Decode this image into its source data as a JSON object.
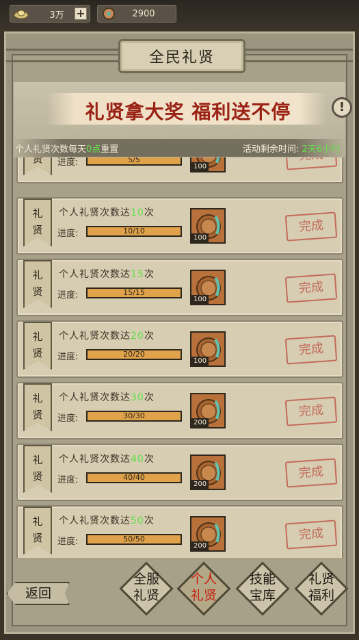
{
  "resources": {
    "gold": {
      "icon": "gold-ingot-icon",
      "value": "3万",
      "add_label": "+"
    },
    "gems": {
      "icon": "jade-coin-icon",
      "value": "2900"
    }
  },
  "title": "全民礼贤",
  "slogan": "礼贤拿大奖 福利送不停",
  "info_label": "!",
  "reset_note": {
    "prefix": "个人礼贤次数每天",
    "time": "0点",
    "suffix": "重置"
  },
  "remaining": {
    "label": "活动剩余时间:",
    "value": "2天6小时"
  },
  "tasks": [
    {
      "ribbon1": "礼",
      "ribbon2": "贤",
      "title_prefix": "",
      "target": "",
      "title_suffix": "",
      "progress_label": "进度:",
      "progress": "5/5",
      "reward_amount": "100",
      "status": "完成"
    },
    {
      "ribbon1": "礼",
      "ribbon2": "贤",
      "title_prefix": "个人礼贤次数达",
      "target": "10",
      "title_suffix": "次",
      "progress_label": "进度:",
      "progress": "10/10",
      "reward_amount": "100",
      "status": "完成"
    },
    {
      "ribbon1": "礼",
      "ribbon2": "贤",
      "title_prefix": "个人礼贤次数达",
      "target": "15",
      "title_suffix": "次",
      "progress_label": "进度:",
      "progress": "15/15",
      "reward_amount": "100",
      "status": "完成"
    },
    {
      "ribbon1": "礼",
      "ribbon2": "贤",
      "title_prefix": "个人礼贤次数达",
      "target": "20",
      "title_suffix": "次",
      "progress_label": "进度:",
      "progress": "20/20",
      "reward_amount": "100",
      "status": "完成"
    },
    {
      "ribbon1": "礼",
      "ribbon2": "贤",
      "title_prefix": "个人礼贤次数达",
      "target": "30",
      "title_suffix": "次",
      "progress_label": "进度:",
      "progress": "30/30",
      "reward_amount": "200",
      "status": "完成"
    },
    {
      "ribbon1": "礼",
      "ribbon2": "贤",
      "title_prefix": "个人礼贤次数达",
      "target": "40",
      "title_suffix": "次",
      "progress_label": "进度:",
      "progress": "40/40",
      "reward_amount": "200",
      "status": "完成"
    },
    {
      "ribbon1": "礼",
      "ribbon2": "贤",
      "title_prefix": "个人礼贤次数达",
      "target": "50",
      "title_suffix": "次",
      "progress_label": "进度:",
      "progress": "50/50",
      "reward_amount": "200",
      "status": "完成"
    }
  ],
  "back_label": "返回",
  "tabs": [
    {
      "line1": "全服",
      "line2": "礼贤",
      "active": false
    },
    {
      "line1": "个人",
      "line2": "礼贤",
      "active": true
    },
    {
      "line1": "技能",
      "line2": "宝库",
      "active": false
    },
    {
      "line1": "礼贤",
      "line2": "福利",
      "active": false
    }
  ],
  "colors": {
    "highlight_green": "#62e04a",
    "active_tab_red": "#c81f10",
    "stamp_red": "#c05a4c",
    "progress_fill": "#e0a24a"
  }
}
